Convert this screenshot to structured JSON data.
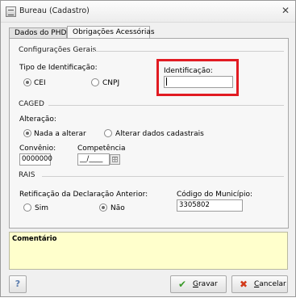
{
  "window": {
    "title": "Bureau (Cadastro)",
    "close_glyph": "✕"
  },
  "tabs": [
    {
      "label": "Dados do PHD",
      "active": false
    },
    {
      "label": "Obrigações Acessórias",
      "active": true
    }
  ],
  "config": {
    "section_title": "Configurações Gerais",
    "tipo_label": "Tipo de Identificação:",
    "options": [
      {
        "label": "CEI",
        "selected": true
      },
      {
        "label": "CNPJ",
        "selected": false
      }
    ],
    "identificacao_label": "Identificação:",
    "identificacao_value": ""
  },
  "caged": {
    "section_title": "CAGED",
    "alteracao_label": "Alteração:",
    "options": [
      {
        "label": "Nada a alterar",
        "selected": true
      },
      {
        "label": "Alterar dados cadastrais",
        "selected": false
      }
    ],
    "convenio_label": "Convênio:",
    "convenio_value": "0000000",
    "competencia_label": "Competência",
    "competencia_value": "__/____"
  },
  "rais": {
    "section_title": "RAIS",
    "retificacao_label": "Retificação da Declaração Anterior:",
    "options": [
      {
        "label": "Sim",
        "selected": false
      },
      {
        "label": "Não",
        "selected": true
      }
    ],
    "municipio_label": "Código do Município:",
    "municipio_value": "3305802"
  },
  "comment": {
    "label": "Comentário"
  },
  "buttons": {
    "help": "?",
    "save": {
      "pre": "",
      "key": "G",
      "post": "ravar"
    },
    "cancel": {
      "pre": "",
      "key": "C",
      "post": "ancelar"
    }
  },
  "colors": {
    "highlight": "#e11b22",
    "comment_bg": "#ffffcc",
    "save_icon": "#3a9a2a",
    "cancel_icon": "#d23a1a"
  }
}
